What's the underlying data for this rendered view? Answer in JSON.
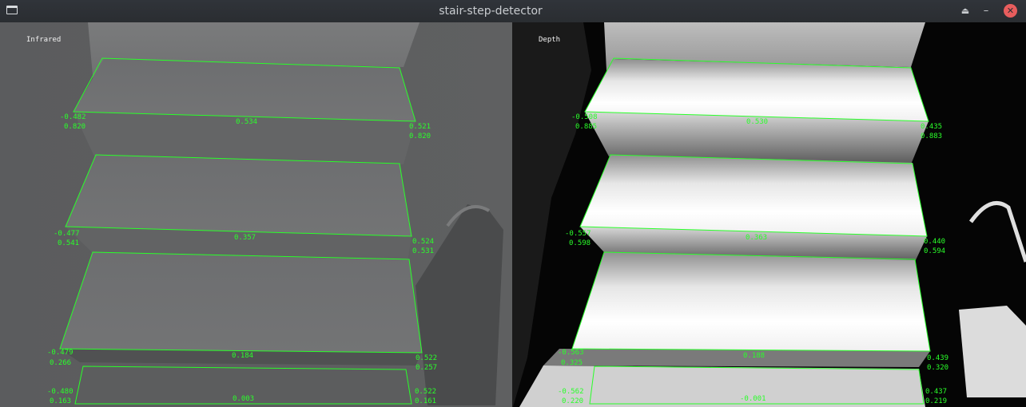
{
  "window": {
    "title": "stair-step-detector",
    "icons": {
      "app": "window-app-icon",
      "keep_above": "eject-icon",
      "minimize": "minimize-icon",
      "close": "close-icon"
    },
    "glyphs": {
      "keep_above": "⏏",
      "minimize": "–",
      "close": "✕"
    }
  },
  "panes": {
    "infrared": {
      "label": "Infrared",
      "steps": [
        {
          "left_top": "-0.482",
          "left_bottom": "0.820",
          "center": "0.534",
          "right_top": "0.521",
          "right_bottom": "0.820"
        },
        {
          "left_top": "-0.477",
          "left_bottom": "0.541",
          "center": "0.357",
          "right_top": "0.524",
          "right_bottom": "0.531"
        },
        {
          "left_top": "-0.479",
          "left_bottom": "0.266",
          "center": "0.184",
          "right_top": "0.522",
          "right_bottom": "0.257"
        },
        {
          "left_top": "-0.480",
          "left_bottom": "0.163",
          "center": "0.003",
          "right_top": "0.522",
          "right_bottom": "0.161"
        }
      ]
    },
    "depth": {
      "label": "Depth",
      "steps": [
        {
          "left_top": "-0.508",
          "left_bottom": "0.885",
          "center": "0.530",
          "right_top": "0.435",
          "right_bottom": "0.883"
        },
        {
          "left_top": "-0.557",
          "left_bottom": "0.598",
          "center": "0.363",
          "right_top": "0.440",
          "right_bottom": "0.594"
        },
        {
          "left_top": "-0.563",
          "left_bottom": "0.325",
          "center": "0.188",
          "right_top": "0.439",
          "right_bottom": "0.320"
        },
        {
          "left_top": "-0.562",
          "left_bottom": "0.220",
          "center": "-0.001",
          "right_top": "0.437",
          "right_bottom": "0.219"
        }
      ]
    }
  },
  "colors": {
    "detection": "#2aff2a",
    "label": "#f2f2f2"
  }
}
